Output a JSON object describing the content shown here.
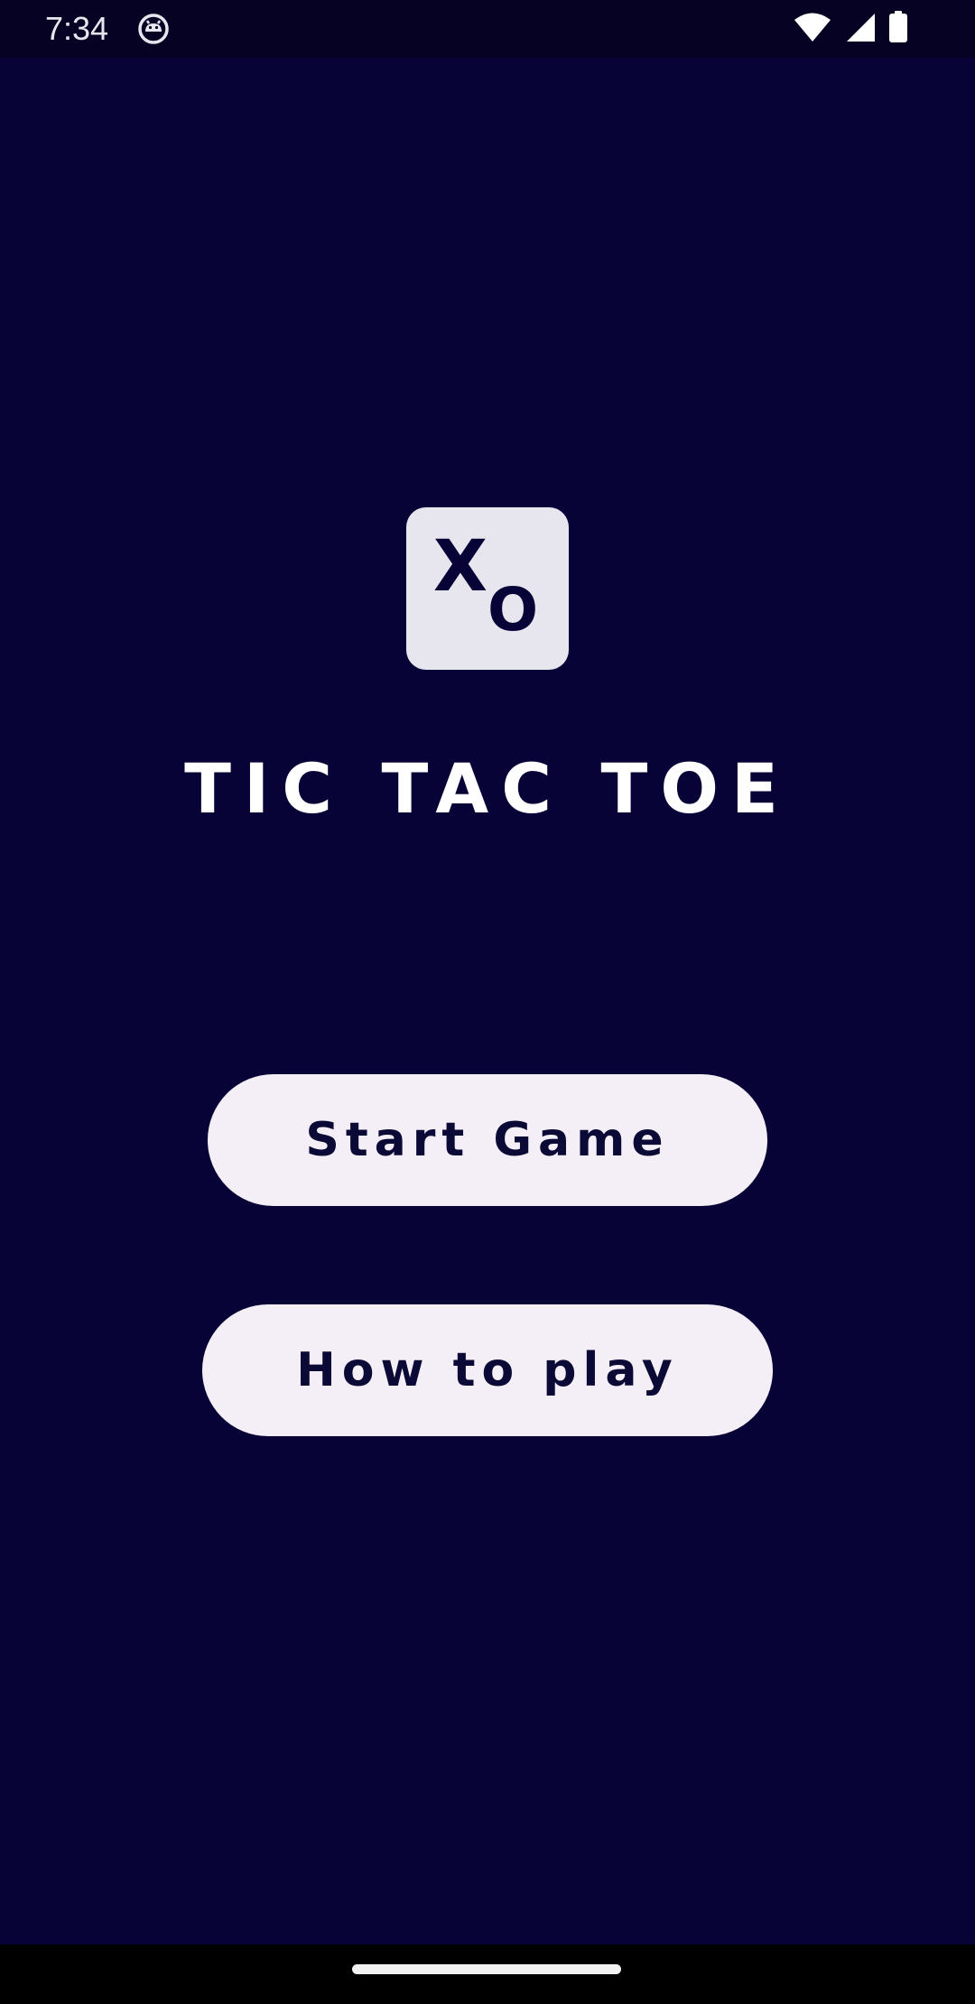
{
  "status_bar": {
    "time": "7:34",
    "app_icon": "android-debug-icon",
    "icons": [
      "wifi-icon",
      "cellular-signal-icon",
      "battery-icon"
    ]
  },
  "logo": {
    "icon": "tic-tac-toe-xo-logo-icon",
    "glyph_x": "X",
    "glyph_o": "O",
    "tile_color": "#e7e6ee",
    "glyph_color": "#070336"
  },
  "title": "TIC TAC TOE",
  "buttons": {
    "start_game": "Start Game",
    "how_to_play": "How to play"
  },
  "colors": {
    "background": "#070336",
    "button_fill": "#f4eff7",
    "button_text": "#0b0935",
    "title_text": "#ffffff"
  },
  "nav_bar": {
    "handle": "home-gesture-handle"
  }
}
